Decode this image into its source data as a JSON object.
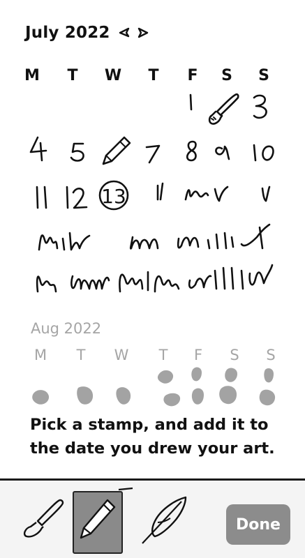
{
  "calendar": {
    "current_month": {
      "title": "July 2022",
      "weekdays": [
        "M",
        "T",
        "W",
        "T",
        "F",
        "S",
        "S"
      ]
    },
    "next_month": {
      "title": "Aug 2022",
      "weekdays": [
        "M",
        "T",
        "W",
        "T",
        "F",
        "S",
        "S"
      ]
    },
    "highlighted_day": "13"
  },
  "instruction": {
    "line1": "Pick a stamp, and add it to",
    "line2": "the date you drew your art."
  },
  "toolbar": {
    "tools": [
      "brush-icon",
      "pen-icon",
      "quill-icon"
    ],
    "selected_tool": "pen-icon",
    "done_label": "Done"
  },
  "colors": {
    "ink": "#111111",
    "muted": "#a5a5a5",
    "selected_tool_bg": "#8a8a8a",
    "done_bg": "#8c8c8c"
  }
}
